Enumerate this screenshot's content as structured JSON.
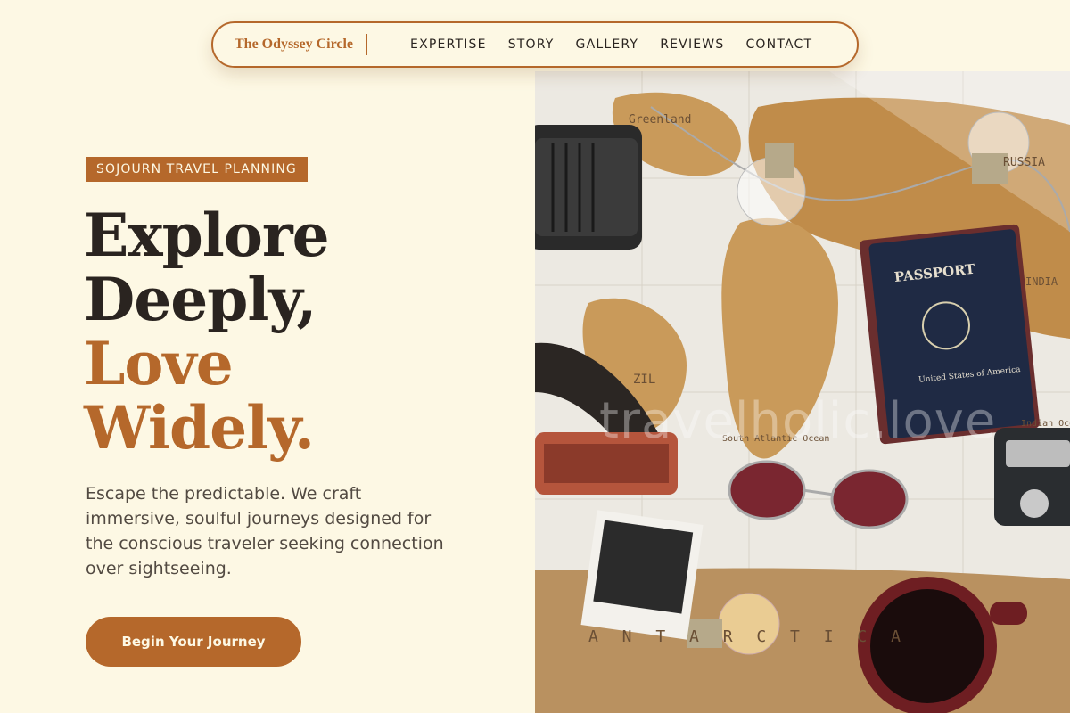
{
  "nav": {
    "brand": "The Odyssey Circle",
    "links": [
      "EXPERTISE",
      "STORY",
      "GALLERY",
      "REVIEWS",
      "CONTACT"
    ]
  },
  "hero": {
    "badge": "SOJOURN TRAVEL PLANNING",
    "headline": {
      "line1": "Explore",
      "line2": "Deeply,",
      "line3": "Love",
      "line4": "Widely."
    },
    "description": "Escape the predictable. We craft immersive, soulful journeys designed for the conscious traveler seeking connection over sightseeing.",
    "cta": "Begin Your Journey"
  },
  "image": {
    "watermark": "travelholic.love",
    "map_labels": {
      "greenland": "Greenland",
      "russia": "RUSSIA",
      "india": "INDIA",
      "brazil": "ZIL",
      "indian_ocean": "Indian Ocean",
      "south_atlantic": "South Atlantic Ocean",
      "antarctica": "A N T A R C T I C A"
    },
    "passport": {
      "title": "PASSPORT",
      "country": "United States of America"
    }
  },
  "colors": {
    "background": "#fdf8e4",
    "accent": "#b5682b",
    "text_dark": "#2a2420",
    "text_body": "#524a42"
  }
}
